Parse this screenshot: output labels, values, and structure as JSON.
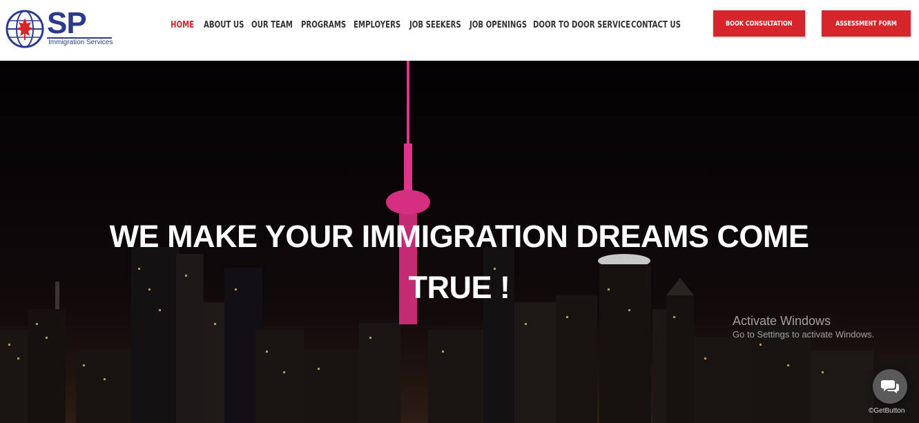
{
  "logo": {
    "text": "SP",
    "subtitle": "Immigration Services"
  },
  "nav": {
    "items": [
      {
        "label": "HOME",
        "active": true
      },
      {
        "label": "ABOUT US"
      },
      {
        "label": "OUR TEAM"
      },
      {
        "label": "PROGRAMS"
      },
      {
        "label": "EMPLOYERS"
      },
      {
        "label": "JOB SEEKERS"
      },
      {
        "label": "JOB OPENINGS"
      },
      {
        "label": "DOOR TO DOOR SERVICE"
      },
      {
        "label": "CONTACT US"
      }
    ]
  },
  "buttons": {
    "book": "BOOK CONSULTATION",
    "assessment": "ASSESSMENT FORM"
  },
  "hero": {
    "line1": "WE MAKE YOUR IMMIGRATION DREAMS COME",
    "line2": "TRUE !"
  },
  "watermark": {
    "title": "Activate Windows",
    "subtitle": "Go to Settings to activate Windows."
  },
  "widget": {
    "brand": "GetButton",
    "icon": "chat-bubbles-icon"
  },
  "colors": {
    "accent": "#d6262b",
    "brand": "#2b3a8f",
    "tower": "#e0338a"
  }
}
